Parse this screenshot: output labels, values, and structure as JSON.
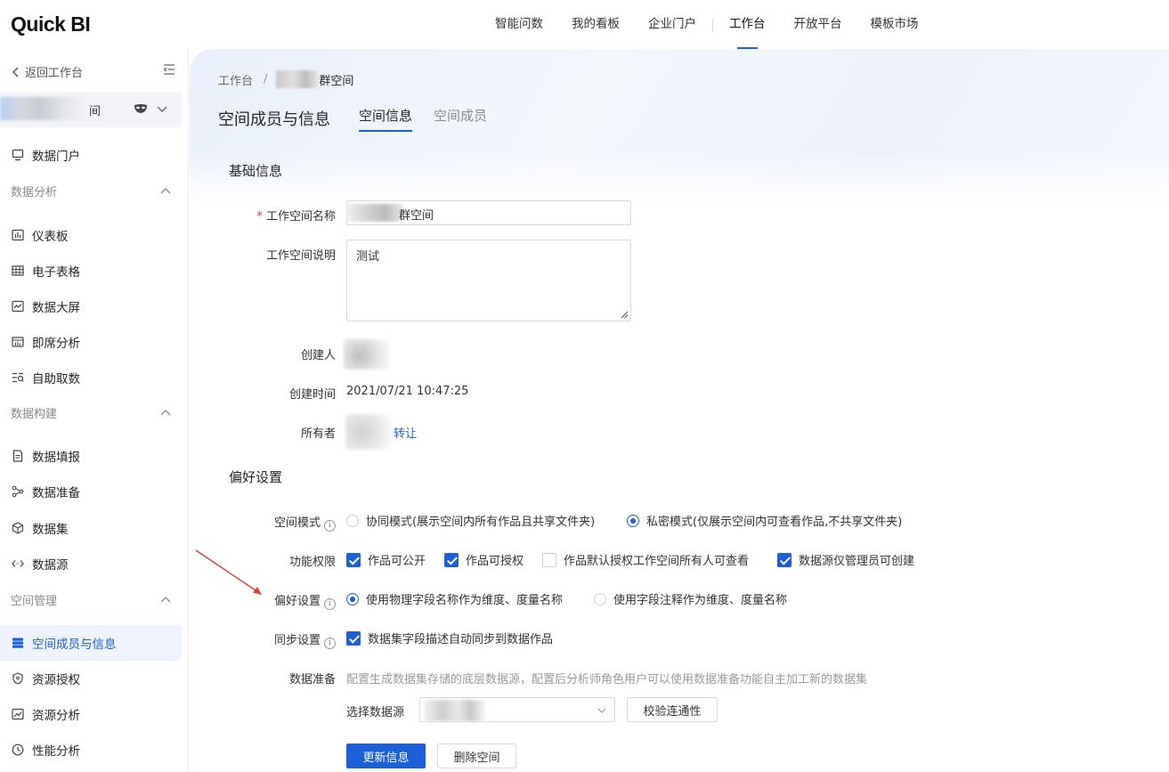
{
  "app": {
    "logo": "Quick BI"
  },
  "top_nav": [
    "智能问数",
    "我的看板",
    "企业门户",
    "工作台",
    "开放平台",
    "模板市场"
  ],
  "sidebar": {
    "back_label": "返回工作台",
    "workspace_name_suffix": "间",
    "items": {
      "portal": "数据门户",
      "group_analysis": "数据分析",
      "dashboard": "仪表板",
      "spreadsheet": "电子表格",
      "screen": "数据大屏",
      "adhoc": "即席分析",
      "selfservice": "自助取数",
      "group_build": "数据构建",
      "fill": "数据填报",
      "prep": "数据准备",
      "dataset": "数据集",
      "source": "数据源",
      "group_space": "空间管理",
      "members": "空间成员与信息",
      "resource": "资源授权",
      "res_analysis": "资源分析",
      "perf": "性能分析"
    }
  },
  "breadcrumb": {
    "root": "工作台",
    "sep": "/",
    "current_suffix": "群空间"
  },
  "page": {
    "title": "空间成员与信息",
    "tabs": [
      "空间信息",
      "空间成员"
    ]
  },
  "basic": {
    "section": "基础信息",
    "name_label": "工作空间名称",
    "name_value_suffix": "群空间",
    "desc_label": "工作空间说明",
    "desc_value": "测试",
    "creator_label": "创建人",
    "created_label": "创建时间",
    "created_value": "2021/07/21 10:47:25",
    "owner_label": "所有者",
    "transfer": "转让"
  },
  "prefs": {
    "section": "偏好设置",
    "mode_label": "空间模式",
    "mode_options": [
      "协同模式(展示空间内所有作品且共享文件夹)",
      "私密模式(仅展示空间内可查看作品,不共享文件夹)"
    ],
    "mode_selected": 1,
    "perm_label": "功能权限",
    "perm_options": [
      {
        "label": "作品可公开",
        "checked": true
      },
      {
        "label": "作品可授权",
        "checked": true
      },
      {
        "label": "作品默认授权工作空间所有人可查看",
        "checked": false
      },
      {
        "label": "数据源仅管理员可创建",
        "checked": true
      }
    ],
    "pref_label": "偏好设置",
    "pref_options": [
      "使用物理字段名称作为维度、度量名称",
      "使用字段注释作为维度、度量名称"
    ],
    "pref_selected": 0,
    "sync_label": "同步设置",
    "sync_option": "数据集字段描述自动同步到数据作品",
    "sync_checked": true,
    "prep_label": "数据准备",
    "prep_desc": "配置生成数据集存储的底层数据源，配置后分析师角色用户可以使用数据准备功能自主加工新的数据集",
    "select_source_label": "选择数据源",
    "check_btn": "校验连通性"
  },
  "actions": {
    "update": "更新信息",
    "delete": "删除空间"
  },
  "colors": {
    "primary": "#1b5fd9",
    "arrow": "#e53935"
  }
}
